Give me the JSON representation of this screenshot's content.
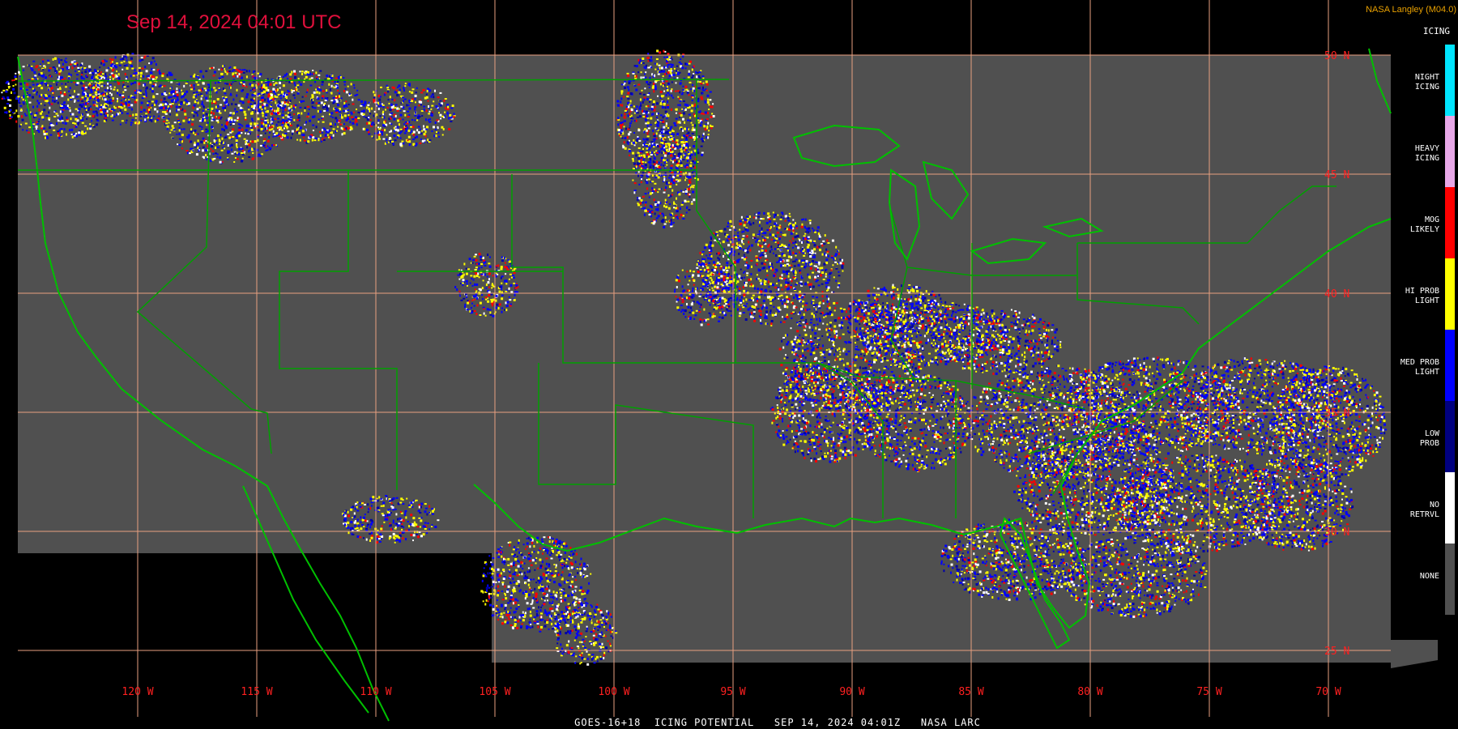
{
  "header": {
    "timestamp": "Sep 14, 2024 04:01 UTC",
    "credit": "NASA Langley (M04.0)"
  },
  "legend": {
    "title": "ICING",
    "items": [
      {
        "label": "NIGHT\nICING",
        "color": "#00e5ff"
      },
      {
        "label": "HEAVY\nICING",
        "color": "#e8a8e8"
      },
      {
        "label": "MOG\nLIKELY",
        "color": "#ff0000"
      },
      {
        "label": "HI PROB\nLIGHT",
        "color": "#ffff00"
      },
      {
        "label": "MED PROB\nLIGHT",
        "color": "#0000ff"
      },
      {
        "label": "LOW\nPROB",
        "color": "#000080"
      },
      {
        "label": "NO\nRETRVL",
        "color": "#ffffff"
      },
      {
        "label": "NONE",
        "color": "#505050"
      }
    ]
  },
  "grid": {
    "longitude_labels": [
      "120 W",
      "115 W",
      "110 W",
      "105 W",
      "100 W",
      "95 W",
      "90 W",
      "85 W",
      "80 W",
      "75 W",
      "70 W"
    ],
    "latitude_labels": [
      "50 N",
      "45 N",
      "40 N",
      "35 N",
      "30 N",
      "25 N"
    ]
  },
  "footer": {
    "text": "GOES-16+18  ICING POTENTIAL   SEP 14, 2024 04:01Z   NASA LARC"
  },
  "colors": {
    "background": "#000000",
    "data_area": "#505050",
    "gridline": "#e8a080",
    "grid_label": "#ff2020",
    "coastline": "#00c000",
    "border": "#00a000"
  }
}
